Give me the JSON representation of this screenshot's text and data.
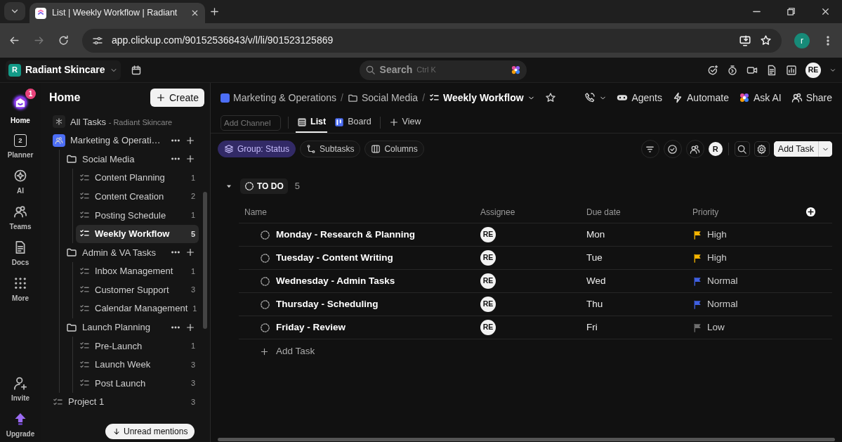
{
  "browser": {
    "tab_title": "List | Weekly Workflow | Radiant",
    "url": "app.clickup.com/90152536843/v/l/li/901523125869",
    "profile_initial": "r"
  },
  "topbar": {
    "workspace_initial": "R",
    "workspace": "Radiant Skincare",
    "search_placeholder": "Search",
    "search_shortcut": "Ctrl K",
    "avatar": "RE"
  },
  "rail": [
    {
      "kind": "home",
      "label": "Home",
      "selected": true,
      "badge": "1"
    },
    {
      "kind": "planner",
      "label": "Planner",
      "selected": false,
      "day": "2"
    },
    {
      "kind": "ai",
      "label": "AI",
      "selected": false
    },
    {
      "kind": "teams",
      "label": "Teams",
      "selected": false
    },
    {
      "kind": "docs",
      "label": "Docs",
      "selected": false
    },
    {
      "kind": "more",
      "label": "More",
      "selected": false
    },
    {
      "kind": "invite",
      "label": "Invite",
      "selected": false
    },
    {
      "kind": "upgrade",
      "label": "Upgrade",
      "selected": false
    }
  ],
  "sidebar": {
    "title": "Home",
    "create_label": "Create",
    "unread_label": "Unread mentions",
    "tree": [
      {
        "kind": "all",
        "label": "All Tasks",
        "sublabel": "- Radiant Skincare"
      },
      {
        "kind": "space",
        "label": "Marketing & Operati…",
        "children": [
          {
            "kind": "folder",
            "label": "Social Media",
            "children": [
              {
                "kind": "list",
                "label": "Content Planning",
                "count": "1",
                "selected": false
              },
              {
                "kind": "list",
                "label": "Content Creation",
                "count": "2",
                "selected": false
              },
              {
                "kind": "list",
                "label": "Posting Schedule",
                "count": "1",
                "selected": false
              },
              {
                "kind": "list",
                "label": "Weekly Workflow",
                "count": "5",
                "selected": true
              }
            ]
          },
          {
            "kind": "folder",
            "label": "Admin & VA Tasks",
            "children": [
              {
                "kind": "list",
                "label": "Inbox Management",
                "count": "1",
                "selected": false
              },
              {
                "kind": "list",
                "label": "Customer Support",
                "count": "3",
                "selected": false
              },
              {
                "kind": "list",
                "label": "Calendar Management",
                "count": "1",
                "selected": false
              }
            ]
          },
          {
            "kind": "folder",
            "label": "Launch Planning",
            "children": [
              {
                "kind": "list",
                "label": "Pre-Launch",
                "count": "1",
                "selected": false
              },
              {
                "kind": "list",
                "label": "Launch Week",
                "count": "3",
                "selected": false
              },
              {
                "kind": "list",
                "label": "Post Launch",
                "count": "3",
                "selected": false
              }
            ]
          }
        ]
      },
      {
        "kind": "list",
        "label": "Project 1",
        "count": "3",
        "selected": false
      }
    ]
  },
  "breadcrumbs": [
    {
      "kind": "space",
      "label": "Marketing & Operations"
    },
    {
      "kind": "folder",
      "label": "Social Media",
      "separator_before": "/"
    },
    {
      "kind": "list",
      "label": "Weekly Workflow",
      "separator_before": "/"
    }
  ],
  "header_actions": [
    {
      "kind": "agents",
      "label": "Agents"
    },
    {
      "kind": "automate",
      "label": "Automate"
    },
    {
      "kind": "ai",
      "label": "Ask AI"
    },
    {
      "kind": "share",
      "label": "Share"
    }
  ],
  "add_channel_placeholder": "Add Channel",
  "views": [
    {
      "kind": "list",
      "label": "List",
      "selected": true
    },
    {
      "kind": "board",
      "label": "Board",
      "selected": false
    }
  ],
  "add_view_label": "View",
  "filters": [
    {
      "kind": "group",
      "label": "Group: Status",
      "selected": true
    },
    {
      "kind": "subtasks",
      "label": "Subtasks",
      "selected": false
    },
    {
      "kind": "columns",
      "label": "Columns",
      "selected": false
    }
  ],
  "me_initial": "R",
  "add_task_button": "Add Task",
  "group": {
    "status": "TO DO",
    "count": "5",
    "expanded": true
  },
  "columns": [
    "Name",
    "Assignee",
    "Due date",
    "Priority"
  ],
  "tasks": [
    {
      "name": "Monday - Research & Planning",
      "assignee": "RE",
      "due": "Mon",
      "priority": "High",
      "color": "#f5b400"
    },
    {
      "name": "Tuesday - Content Writing",
      "assignee": "RE",
      "due": "Tue",
      "priority": "High",
      "color": "#f5b400"
    },
    {
      "name": "Wednesday - Admin Tasks",
      "assignee": "RE",
      "due": "Wed",
      "priority": "Normal",
      "color": "#3f5fe0"
    },
    {
      "name": "Thursday - Scheduling",
      "assignee": "RE",
      "due": "Thu",
      "priority": "Normal",
      "color": "#3f5fe0"
    },
    {
      "name": "Friday - Review",
      "assignee": "RE",
      "due": "Fri",
      "priority": "Low",
      "color": "#6e6e6e"
    }
  ],
  "add_task_row": "Add Task"
}
